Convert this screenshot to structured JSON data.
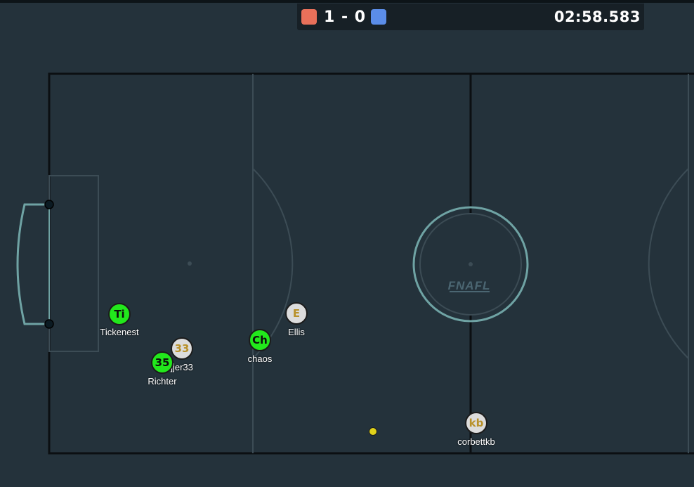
{
  "scoreboard": {
    "score_text": "1 - 0",
    "clock": "02:58.583",
    "red_color": "#e8705a",
    "blue_color": "#5b8de8"
  },
  "field": {
    "watermark": "FNAFL",
    "line_color": "#0b0f12",
    "field_color": "#24323b"
  },
  "players": [
    {
      "initials": "Ti",
      "name": "Tickenest",
      "team": "green"
    },
    {
      "initials": "33",
      "name": "jjer33",
      "team": "gray"
    },
    {
      "initials": "35",
      "name": "Richter",
      "team": "green"
    },
    {
      "initials": "Ch",
      "name": "chaos",
      "team": "green"
    },
    {
      "initials": "E",
      "name": "Ellis",
      "team": "gray"
    },
    {
      "initials": "kb",
      "name": "corbettkb",
      "team": "gray"
    }
  ],
  "ball": {
    "color": "#e0d21a"
  }
}
